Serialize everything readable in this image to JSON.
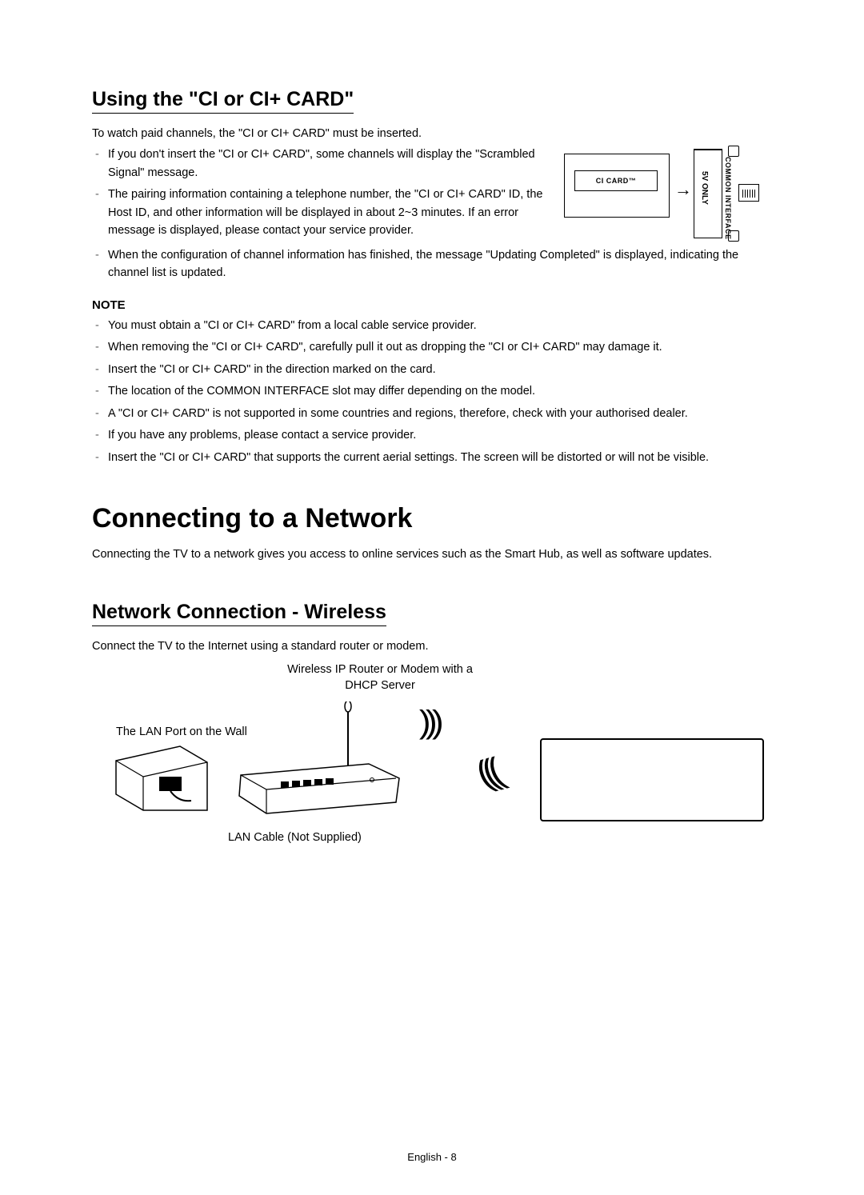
{
  "section1": {
    "heading": "Using the \"CI or CI+ CARD\"",
    "intro": "To watch paid channels, the \"CI or CI+ CARD\" must be inserted.",
    "bullets_a": [
      "If you don't insert the \"CI or CI+ CARD\", some channels will display the \"Scrambled Signal\" message.",
      "The pairing information containing a telephone number, the \"CI or CI+ CARD\" ID, the Host ID, and other information will be displayed in about 2~3 minutes. If an error message is displayed, please contact your service provider."
    ],
    "bullets_b": [
      "When the configuration of channel information has finished, the message \"Updating Completed\" is displayed, indicating the channel list is updated."
    ],
    "diagram": {
      "card_label": "CI CARD™",
      "slot_label_inner": "5V ONLY",
      "slot_label_outer": "COMMON INTERFACE"
    },
    "note_heading": "NOTE",
    "note_bullets": [
      "You must obtain a \"CI or CI+ CARD\" from a local cable service provider.",
      "When removing the \"CI or CI+ CARD\", carefully pull it out as dropping the \"CI or CI+ CARD\" may damage it.",
      "Insert the \"CI or CI+ CARD\" in the direction marked on the card.",
      "The location of the COMMON INTERFACE slot may differ depending on the model.",
      "A \"CI or CI+ CARD\" is not supported in some countries and regions, therefore, check with your authorised dealer.",
      "If you have any problems, please contact a service provider.",
      "Insert the \"CI or CI+ CARD\" that supports the current aerial settings. The screen will be distorted or will not be visible."
    ]
  },
  "section2": {
    "heading": "Connecting to a Network",
    "intro": "Connecting the TV to a network gives you access to online services such as the Smart Hub, as well as software updates."
  },
  "section3": {
    "heading": "Network Connection - Wireless",
    "intro": "Connect the TV to the Internet using a standard router or modem.",
    "labels": {
      "router": "Wireless IP Router or Modem with a DHCP Server",
      "wall": "The LAN Port on the Wall",
      "lan": "LAN Cable (Not Supplied)"
    }
  },
  "footer": "English - 8"
}
